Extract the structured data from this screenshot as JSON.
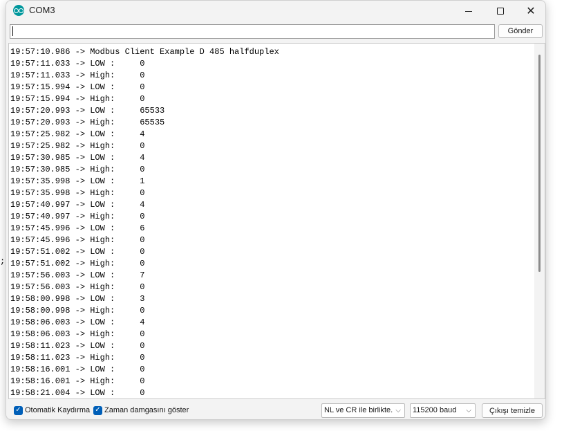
{
  "stray_char": ";",
  "window": {
    "title": "COM3",
    "app_icon": "arduino-icon",
    "controls": {
      "minimize": "minimize-icon",
      "maximize": "maximize-icon",
      "close": "close-icon",
      "close_glyph": "✕"
    }
  },
  "send": {
    "input_value": "",
    "button_label": "Gönder"
  },
  "output": {
    "lines": [
      "19:57:10.986 -> Modbus Client Example D 485 halfduplex",
      "19:57:11.033 -> LOW :     0",
      "19:57:11.033 -> High:     0",
      "19:57:15.994 -> LOW :     0",
      "19:57:15.994 -> High:     0",
      "19:57:20.993 -> LOW :     65533",
      "19:57:20.993 -> High:     65535",
      "19:57:25.982 -> LOW :     4",
      "19:57:25.982 -> High:     0",
      "19:57:30.985 -> LOW :     4",
      "19:57:30.985 -> High:     0",
      "19:57:35.998 -> LOW :     1",
      "19:57:35.998 -> High:     0",
      "19:57:40.997 -> LOW :     4",
      "19:57:40.997 -> High:     0",
      "19:57:45.996 -> LOW :     6",
      "19:57:45.996 -> High:     0",
      "19:57:51.002 -> LOW :     0",
      "19:57:51.002 -> High:     0",
      "19:57:56.003 -> LOW :     7",
      "19:57:56.003 -> High:     0",
      "19:58:00.998 -> LOW :     3",
      "19:58:00.998 -> High:     0",
      "19:58:06.003 -> LOW :     4",
      "19:58:06.003 -> High:     0",
      "19:58:11.023 -> LOW :     0",
      "19:58:11.023 -> High:     0",
      "19:58:16.001 -> LOW :     0",
      "19:58:16.001 -> High:     0",
      "19:58:21.004 -> LOW :     0"
    ]
  },
  "bottom": {
    "autoscroll": {
      "label": "Otomatik Kaydırma",
      "checked": true
    },
    "timestamp": {
      "label": "Zaman damgasını göster",
      "checked": true
    },
    "check_glyph": "✓",
    "chevron_glyph": "⌵",
    "line_ending": {
      "selected": "NL ve CR ile birlikte."
    },
    "baud": {
      "selected": "115200 baud"
    },
    "clear_label": "Çıkışı temizle"
  },
  "colors": {
    "accent": "#005fb8",
    "icon_teal": "#00979c"
  }
}
